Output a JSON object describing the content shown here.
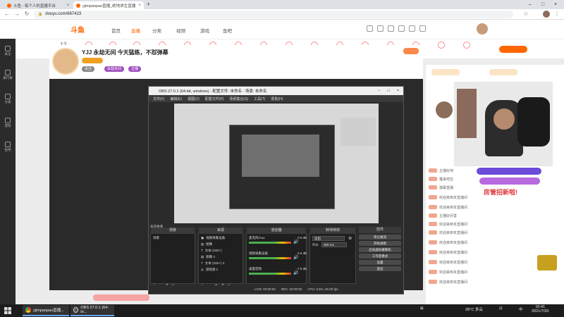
{
  "browser": {
    "tabs": [
      {
        "label": "斗鱼 - 每个人的直播平台",
        "active": false
      },
      {
        "label": "yjimpanpao直播_绝地求生直播",
        "active": true
      }
    ],
    "url": "douyu.com/667423",
    "new_tab": "+"
  },
  "site": {
    "logo": "斗鱼",
    "nav": [
      "首页",
      "直播",
      "分类",
      "视频",
      "游戏",
      "鱼吧"
    ],
    "nav_active_index": 1,
    "categories": [
      "12",
      "",
      "",
      "",
      "",
      "",
      "",
      "",
      "",
      "",
      "",
      "",
      "",
      "",
      "",
      "",
      "",
      "",
      "",
      "",
      "",
      "",
      "",
      "",
      ""
    ],
    "rail": [
      "关注",
      "排行榜",
      "分类",
      "游戏",
      "鱼吧"
    ]
  },
  "room": {
    "title": "YJJ 永劫无间 今天猛练，不怼弹幕",
    "follow_label": "关注",
    "chips": [
      "永劫无间",
      "主播"
    ]
  },
  "obs": {
    "title": "OBS 27.0.1 (64-bit, windows) - 配置文件: 未命名 - 场景: 未命名",
    "menu": [
      "文件(F)",
      "编辑(E)",
      "视图(V)",
      "配置文件(P)",
      "场景集合(S)",
      "工具(T)",
      "帮助(H)"
    ],
    "panels": {
      "scenes": "场景",
      "sources": "来源",
      "mixer": "混音器",
      "transitions": "转场特效",
      "controls": "控件"
    },
    "scene_items": [
      "场景"
    ],
    "source_items": [
      "视频采集设备",
      "图像",
      "文本 (GDI+)",
      "图像 2",
      "文本 (GDI+) 2",
      "游戏源 2"
    ],
    "mixer_items": [
      {
        "name": "麦克风/Aux",
        "level": "0.0 dB"
      },
      {
        "name": "视频采集设备",
        "level": "0.0 dB"
      },
      {
        "name": "桌面音频",
        "level": "-7.6 dB"
      }
    ],
    "transition": {
      "type": "淡出",
      "duration_label": "时长",
      "duration": "300 ms"
    },
    "controls": [
      "停止推流",
      "开始录制",
      "启动虚拟摄像机",
      "工作室模式",
      "设置",
      "退出"
    ],
    "status": [
      "LIVE: 00:00:00",
      "REC: 00:00:00",
      "CPU: 3.5%, 60.00 fps"
    ],
    "toolbar_hint": "未选择源"
  },
  "chat": {
    "lines": [
      "主播好帅",
      "猫来吧宝",
      "弹幕直播",
      "欢迎来到本直播间",
      "欢迎来到本直播间",
      "主播好厉害",
      "欢迎来到本直播间",
      "欢迎来到本直播间",
      "欢迎来到本直播间",
      "欢迎来到本直播间",
      "欢迎来到本直播间",
      "欢迎来到本直播间",
      "欢迎来到本直播间"
    ],
    "banner": "房管招新啦!"
  },
  "taskbar": {
    "items": [
      "yjimpanpao直播...",
      "OBS 27.0.1 (64-bi..."
    ],
    "weather": "28°C 多云",
    "time": "10:41",
    "date": "2021/7/20",
    "lang": "中"
  }
}
